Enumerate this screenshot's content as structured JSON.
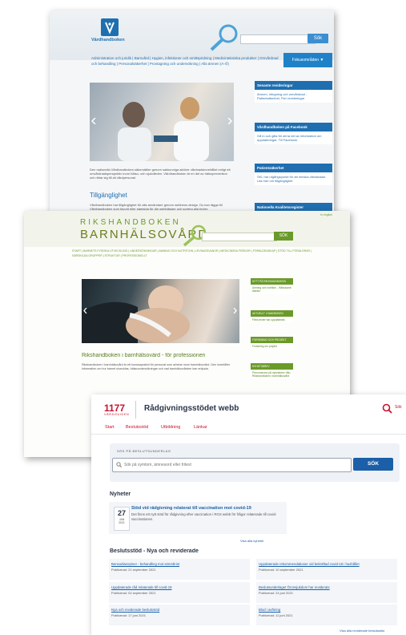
{
  "vardhandboken": {
    "logo_text": "Vårdhandboken",
    "search_button": "Sök",
    "nav_text": "Administration och juridik | Barnvård | Hygien, infektioner och smittspridning | Medicintekniska produkter | Omvårdnad och behandling | Personalsäkerhet | Provtagning och undersökning | Alla ämnen (A-Ö)",
    "nav_button": "Fokusområden ▼",
    "intro_text": "Den nationella Vårdhandboken säkerställer genom sakkunniga aktörer vårdnadsinnehållet enligt ett omvårdnadsperspektiv inom hälso- och sjukvården. Vårdhandboken är en del av hälsoprevention och riktar sig till all vårdpersonal.",
    "heading": "Tillgänglighet",
    "body_text": "Vårdhandboken har tillgänglighet för alla användare genom webbens design. Du kan lägga till Vårdhandboken som favorit eller startsida för din webbläsare och sortera alla texter.",
    "panels": [
      {
        "title": "Senaste revideringar",
        "text": "Ämnen, infogning och omvårdnad - Patientsäkerhet, Fler revideringar"
      },
      {
        "title": "Vårdhandboken på Facebook",
        "text": "Gå in och gilla för att ta del av information om uppdateringar. Till Facebook"
      },
      {
        "title": "Patientsäkerhet",
        "text": "SKL har utgångspunkt för att minska vårdskador. Läs mer om tillgänglighet"
      },
      {
        "title": "Nationella Kvalitetsregister",
        "text": ""
      }
    ]
  },
  "rikshandboken": {
    "brand_top": "RIKSHANDBOKEN",
    "brand_bottom": "BARNHÄLSOVÅRD",
    "search_button": "SÖK",
    "lang_link": "In english",
    "nav_text": "START | BARNETS FYSISKA UTVECKLING | UNDERSÖKNINGAR | AMNING OCH NUTRITION | LEVNADSVANOR | MEDICINSKA FRÅGOR | FÖRÄLDRASKAP | STÖD TILL FÖRÄLDRAR | SÄRSKILDA GRUPPER | STRUKTUR | PROFESSIONELLT",
    "heading": "Rikshandboken i barnhälsovård - för professionen",
    "body_text": "Rikshandboken i barnhälsovård är ett kunskapsstöd för personal som arbetar inom barnhälsovård. Den innehåller information om hur barnet utvecklas, hälsoundersökningar och vad barnhälsovården kan erbjuda.",
    "panels": [
      {
        "title": "NYTT PÅ RIKSHANDBOKEN",
        "text": "Amning och nutrition - Hälsosamt ätande"
      },
      {
        "title": "AKTUELLT I HANDBOKEN",
        "text": "Flera texter har uppdaterats"
      },
      {
        "title": "FORSKNING OCH PROJEKT",
        "text": "Forskning om projekt"
      },
      {
        "title": "NYHETSBREV",
        "text": "Prenumerera på nyhetsbrev från Rikshandboken i barnhälsovård"
      }
    ]
  },
  "radgivning": {
    "logo_number": "1177",
    "logo_sub": "VÅRDGUIDEN",
    "title": "Rådgivningsstödet webb",
    "search_link": "Sök",
    "nav": [
      "Start",
      "Beslutsstöd",
      "Utbildning",
      "Länkar"
    ],
    "search_label": "SÖK PÅ BESLUTSUNDERLAG",
    "search_placeholder": "Sök på symtom, ämnesord eller fritext",
    "search_button": "SÖK",
    "news_heading": "Nyheter",
    "news_day": "27",
    "news_month": "JAN",
    "news_year": "2021",
    "news_title": "Stöd vid rådgivning relaterat till vaccination mot covid-19",
    "news_desc": "Det finns ett nytt stöd för rådgivning efter vaccination i RGS webb för frågor relaterade till covid-vaccinationen.",
    "all_news": "Visa alla nyheter",
    "decisions_heading": "Beslutsstöd - Nya och reviderade",
    "cards": [
      {
        "title": "Bensodiazepiner - behandling mot sömnbrist",
        "date": "Publicerad: 21 september 2021"
      },
      {
        "title": "Uppdaterade rekommendationer vid bekräftad covid-19 i hushållet",
        "date": "Publicerad: 10 september 2021"
      },
      {
        "title": "Uppdaterade råd relaterade till covid-19",
        "date": "Publicerad: 02 september 2021"
      },
      {
        "title": "Beslutsunderlaget Öronsjukdom har reviderats",
        "date": "Publicerad: 24 juni 2021"
      },
      {
        "title": "Nya och reviderade beslutsstöd",
        "date": "Publicerad: 17 juni 2021"
      },
      {
        "title": "Blod i avföring",
        "date": "Publicerad: 11 juni 2021"
      }
    ],
    "all_decisions": "Visa alla reviderade beslutsstöd"
  },
  "colors": {
    "vardhandboken_blue": "#1f6fb0",
    "rikshandboken_green": "#6a9a2a",
    "radgivning_red": "#c8102e",
    "radgivning_blue": "#1a5fa8"
  }
}
